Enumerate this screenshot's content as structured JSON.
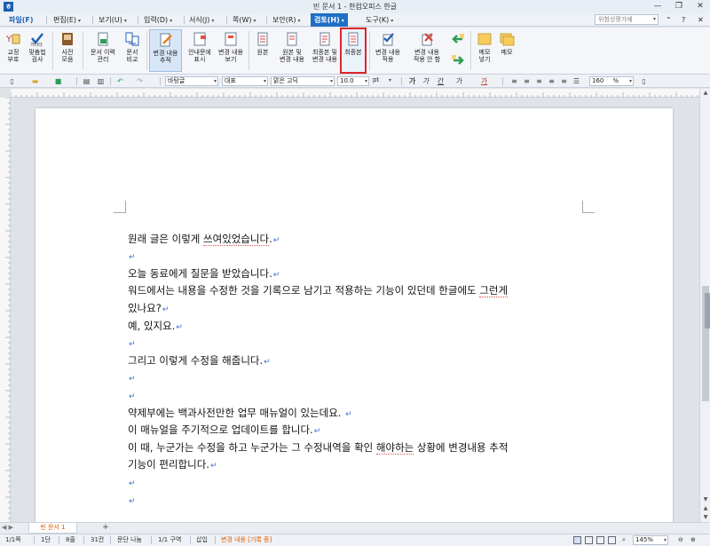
{
  "window": {
    "title": "빈 문서 1 - 한컴오피스 한글",
    "app_icon": "hwp-app-icon",
    "minimize": "—",
    "restore": "❐",
    "close": "✕"
  },
  "menubar": {
    "items": [
      {
        "label": "파일(F)"
      },
      {
        "label": "편집(E)"
      },
      {
        "label": "보기(U)"
      },
      {
        "label": "입력(D)"
      },
      {
        "label": "서식(J)"
      },
      {
        "label": "쪽(W)"
      },
      {
        "label": "보안(R)"
      },
      {
        "label": "검토(H)",
        "active": true
      },
      {
        "label": "도구(K)"
      }
    ],
    "help_search_placeholder": "위험성평가예",
    "collapse": "⌃",
    "help": "?",
    "close_doc": "✕"
  },
  "ribbon": {
    "buttons": [
      {
        "label": "교정\n부호",
        "icon": "proofreading-marks-icon",
        "dropdown": true
      },
      {
        "label": "맞춤법\n검사",
        "icon": "spellcheck-icon",
        "dropdown": true
      },
      {
        "label": "사전\n모음",
        "icon": "dictionary-icon",
        "dropdown": true
      },
      {
        "label": "문서 이력\n관리",
        "icon": "document-history-icon"
      },
      {
        "label": "문서\n비교",
        "icon": "document-compare-icon"
      },
      {
        "label": "변경 내용\n추적",
        "icon": "track-changes-icon",
        "dropdown": true,
        "pressed": true
      },
      {
        "label": "안내문에\n표시",
        "icon": "show-in-balloons-icon"
      },
      {
        "label": "변경 내용\n보기",
        "icon": "view-changes-icon",
        "dropdown": true
      },
      {
        "label": "원본",
        "icon": "original-icon"
      },
      {
        "label": "원본 및\n변경 내용",
        "icon": "original-with-changes-icon"
      },
      {
        "label": "최종본 및\n변경 내용",
        "icon": "final-with-changes-icon"
      },
      {
        "label": "최종본",
        "icon": "final-icon",
        "highlighted": true
      },
      {
        "label": "변경 내용\n적용",
        "icon": "accept-change-icon",
        "dropdown": true
      },
      {
        "label": "변경 내용\n적용 안 함",
        "icon": "reject-change-icon",
        "dropdown": true
      },
      {
        "label": "",
        "icon": "previous-change-icon"
      },
      {
        "label": "",
        "icon": "next-change-icon"
      },
      {
        "label": "메모\n넣기",
        "icon": "insert-memo-icon"
      },
      {
        "label": "메모",
        "icon": "memo-icon",
        "dropdown": true
      }
    ]
  },
  "formatbar": {
    "style": "바탕글",
    "lang": "대표",
    "font": "맑은 고딕",
    "size": "10.0",
    "unit": "pt",
    "bold": "가",
    "italic": "가",
    "underline": "간",
    "strike": "가",
    "zoom": "160",
    "zoom_unit": "%"
  },
  "document": {
    "lines": [
      {
        "text": "",
        "mark": ""
      },
      {
        "text": "원래 글은 이렇게 쓰여있었습니다.",
        "mark": "↵"
      },
      {
        "text": "",
        "mark": "↵"
      },
      {
        "text": "오늘 동료에게 질문을 받았습니다.",
        "mark": "↵"
      },
      {
        "text": "워드에서는 내용을 수정한 것을 기록으로 남기고 적용하는 기능이 있던데 한글에도 그런게",
        "mark": ""
      },
      {
        "text": "있나요?",
        "mark": "↵"
      },
      {
        "text": "예, 있지요.",
        "mark": "↵"
      },
      {
        "text": "",
        "mark": "↵"
      },
      {
        "text": " 그리고 이렇게 수정을 해줍니다.",
        "mark": "↵"
      },
      {
        "text": "",
        "mark": "↵"
      },
      {
        "text": "",
        "mark": "↵"
      },
      {
        "text": "약제부에는 백과사전만한 업무 매뉴얼이 있는데요. ",
        "mark": "↵"
      },
      {
        "text": "이 매뉴얼을 주기적으로 업데이트를 합니다.",
        "mark": "↵"
      },
      {
        "text": "이 때, 누군가는 수정을 하고 누군가는 그 수정내역을 확인 해야하는 상황에 변경내용 추적",
        "mark": ""
      },
      {
        "text": "기능이 편리합니다.",
        "mark": "↵"
      },
      {
        "text": "",
        "mark": "↵"
      },
      {
        "text": "",
        "mark": "↵"
      }
    ]
  },
  "tabs": {
    "document_tab": "빈 문서 1",
    "add_tab": "+",
    "nav": "◀ ▶"
  },
  "status": {
    "page": "1/1쪽",
    "column": "1단",
    "line": "8줄",
    "col": "31칸",
    "para": "문단 나눔",
    "section": "1/1 구역",
    "mode": "삽입",
    "tracking": "변경 내용 [기록 중]",
    "zoom": "145%",
    "zoom_out": "⊖",
    "zoom_in": "⊕"
  }
}
